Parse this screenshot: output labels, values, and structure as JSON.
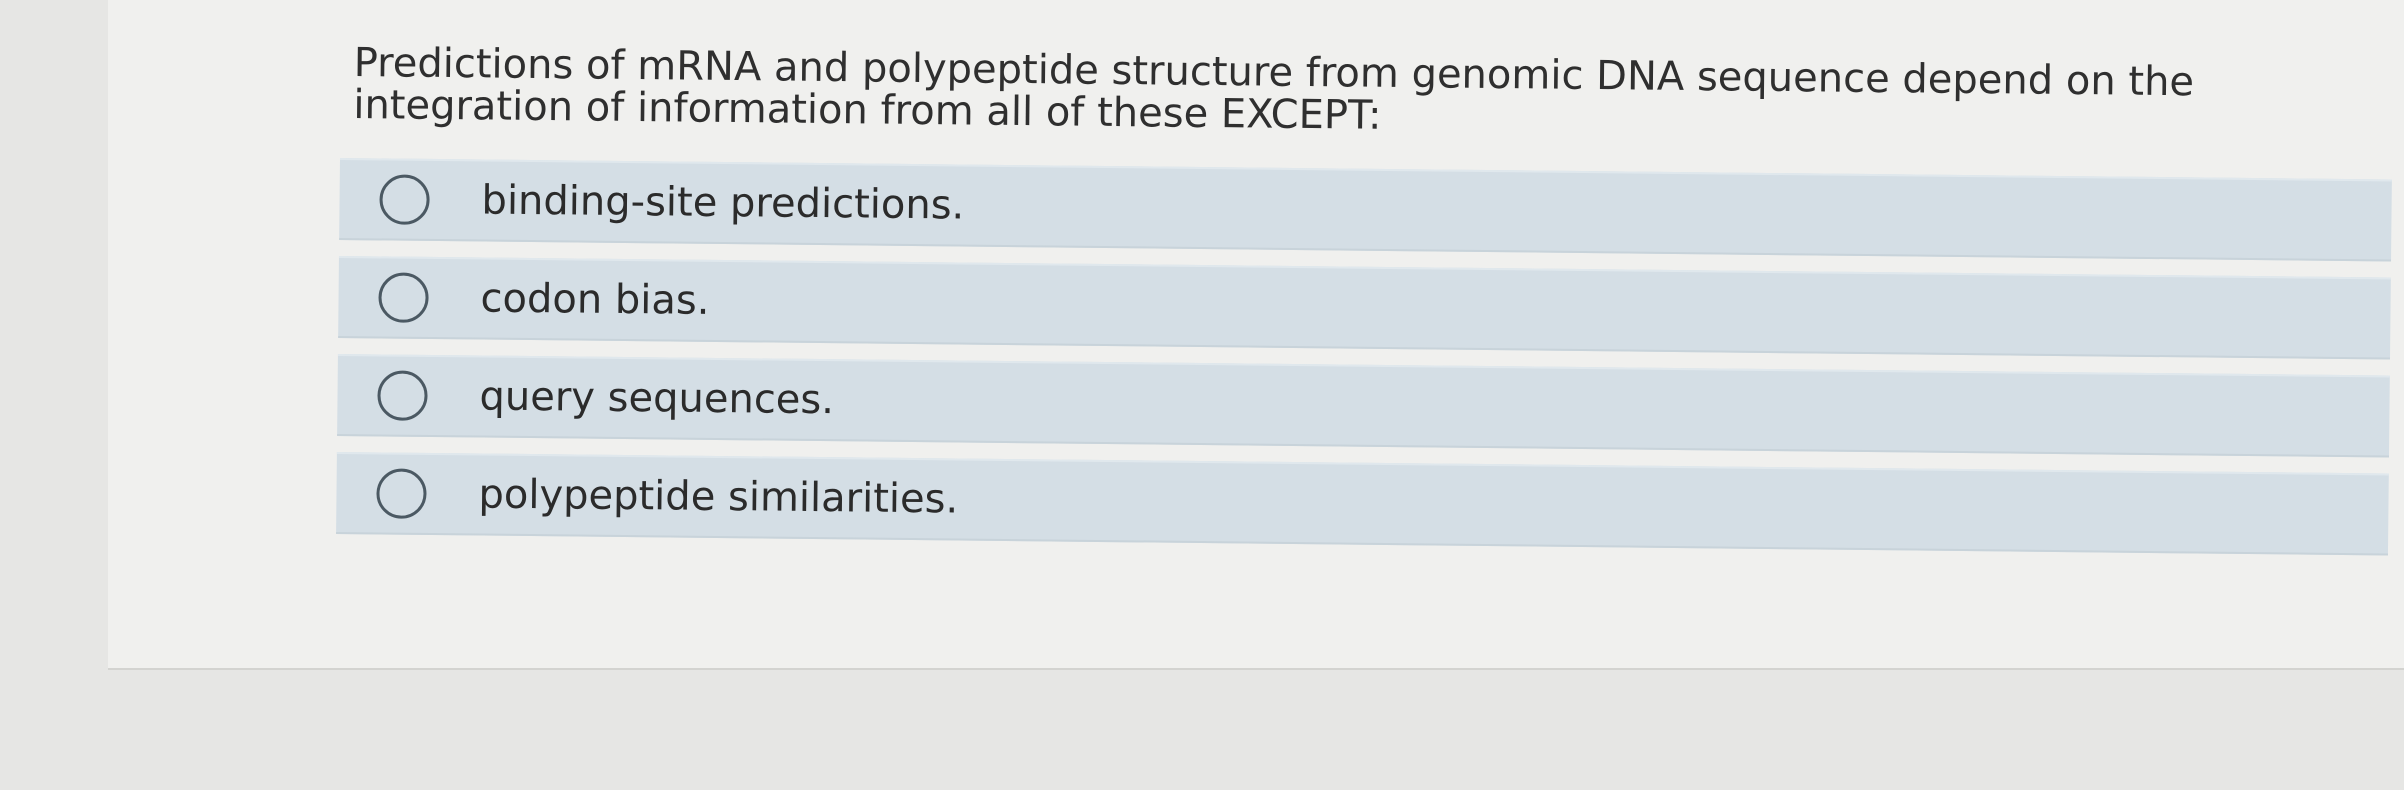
{
  "question": {
    "text": "Predictions of mRNA and polypeptide structure from genomic DNA sequence depend on the integration of information from all of these EXCEPT:"
  },
  "options": [
    {
      "label": "binding-site predictions."
    },
    {
      "label": "codon bias."
    },
    {
      "label": "query sequences."
    },
    {
      "label": "polypeptide similarities."
    }
  ]
}
